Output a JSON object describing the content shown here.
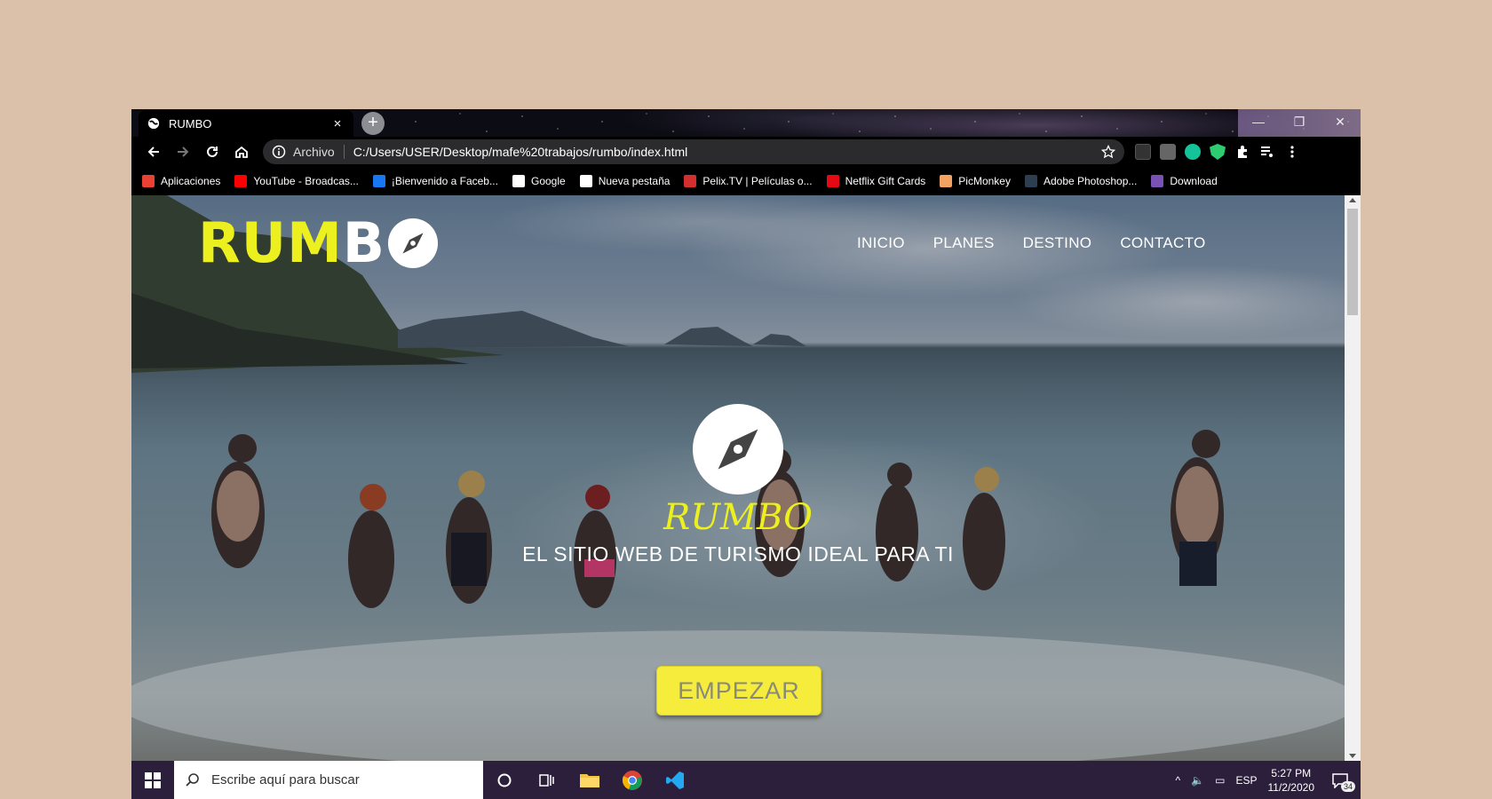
{
  "browser": {
    "tab": {
      "title": "RUMBO",
      "close": "×"
    },
    "new_tab": "+",
    "window_controls": [
      "—",
      "❐",
      "✕"
    ],
    "omnibox": {
      "chip": "Archivo",
      "url": "C:/Users/USER/Desktop/mafe%20trabajos/rumbo/index.html"
    },
    "bookmarks": [
      {
        "label": "Aplicaciones",
        "icon": "apps-grid-icon",
        "color": "#e94235"
      },
      {
        "label": "YouTube - Broadcas...",
        "icon": "youtube-icon",
        "color": "#ff0000"
      },
      {
        "label": "¡Bienvenido a Faceb...",
        "icon": "facebook-icon",
        "color": "#1877f2"
      },
      {
        "label": "Google",
        "icon": "google-icon",
        "color": "#ffffff"
      },
      {
        "label": "Nueva pestaña",
        "icon": "globe-icon",
        "color": "#ffffff"
      },
      {
        "label": "Pelix.TV | Películas o...",
        "icon": "pelix-icon",
        "color": "#d32f2f"
      },
      {
        "label": "Netflix Gift Cards",
        "icon": "netflix-icon",
        "color": "#e50914"
      },
      {
        "label": "PicMonkey",
        "icon": "picmonkey-icon",
        "color": "#f4a261"
      },
      {
        "label": "Adobe Photoshop...",
        "icon": "adobe-icon",
        "color": "#2d3e50"
      },
      {
        "label": "Download",
        "icon": "bootstrap-icon",
        "color": "#7952b3"
      }
    ]
  },
  "site": {
    "logo": {
      "main": "RUM",
      "accent": "B"
    },
    "logo_m_split": "M",
    "nav": [
      "INICIO",
      "PLANES",
      "DESTINO",
      "CONTACTO"
    ],
    "hero": {
      "brand": "RUMBO",
      "tagline": "EL SITIO WEB DE TURISMO IDEAL PARA TI",
      "button": "EMPEZAR"
    },
    "colors": {
      "brand_yellow": "#ecf01f",
      "button_yellow": "#f6ec3b"
    }
  },
  "taskbar": {
    "search_placeholder": "Escribe aquí para buscar",
    "language": "ESP",
    "time": "5:27 PM",
    "date": "11/2/2020",
    "notifications": "34"
  }
}
